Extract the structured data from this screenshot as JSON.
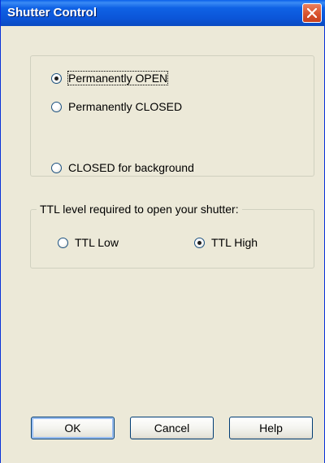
{
  "window": {
    "title": "Shutter Control"
  },
  "shutter_mode": {
    "options": [
      {
        "label": "Permanently OPEN",
        "checked": true
      },
      {
        "label": "Permanently CLOSED",
        "checked": false
      },
      {
        "label": "CLOSED for background",
        "checked": false
      }
    ]
  },
  "ttl": {
    "legend": "TTL level required to open your shutter:",
    "options": [
      {
        "label": "TTL Low",
        "checked": false
      },
      {
        "label": "TTL High",
        "checked": true
      }
    ]
  },
  "buttons": {
    "ok": "OK",
    "cancel": "Cancel",
    "help": "Help"
  },
  "icons": {
    "close": "close-icon"
  },
  "colors": {
    "titlebar": "#0b55d8",
    "close_button": "#d9532e",
    "dialog_bg": "#ece9d8"
  }
}
